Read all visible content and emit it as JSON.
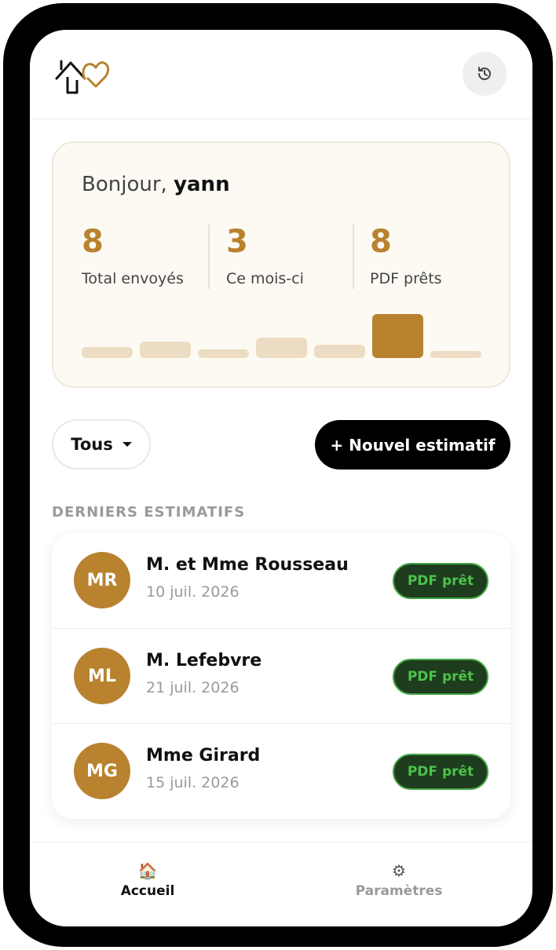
{
  "header": {
    "logo_icon": "house-heart-icon",
    "history_icon": "history-icon",
    "brand_color": "#b8822f"
  },
  "stats": {
    "greeting_prefix": "Bonjour,",
    "user_name": "yann",
    "items": [
      {
        "value": "8",
        "label": "Total envoyés"
      },
      {
        "value": "3",
        "label": "Ce mois-ci"
      },
      {
        "value": "8",
        "label": "PDF prêts"
      }
    ],
    "activity_bars": [
      0.25,
      0.38,
      0.2,
      0.47,
      0.3,
      1.0,
      0.16
    ],
    "activity_active_index": 5
  },
  "actions": {
    "filter_label": "Tous",
    "new_label": "+ Nouvel estimatif"
  },
  "list": {
    "title": "DERNIERS ESTIMATIFS",
    "items": [
      {
        "initials": "MR",
        "name": "M. et Mme Rousseau",
        "date": "10 juil. 2026",
        "status": "PDF prêt"
      },
      {
        "initials": "ML",
        "name": "M. Lefebvre",
        "date": "21 juil. 2026",
        "status": "PDF prêt"
      },
      {
        "initials": "MG",
        "name": "Mme Girard",
        "date": "15 juil. 2026",
        "status": "PDF prêt"
      }
    ]
  },
  "nav": {
    "items": [
      {
        "icon": "🏠",
        "icon_name": "house-icon",
        "label": "Accueil",
        "active": true
      },
      {
        "icon": "⚙",
        "icon_name": "gear-icon",
        "label": "Paramètres",
        "active": false
      }
    ],
    "active_color": "#111111",
    "inactive_color": "#9a9a9a"
  }
}
